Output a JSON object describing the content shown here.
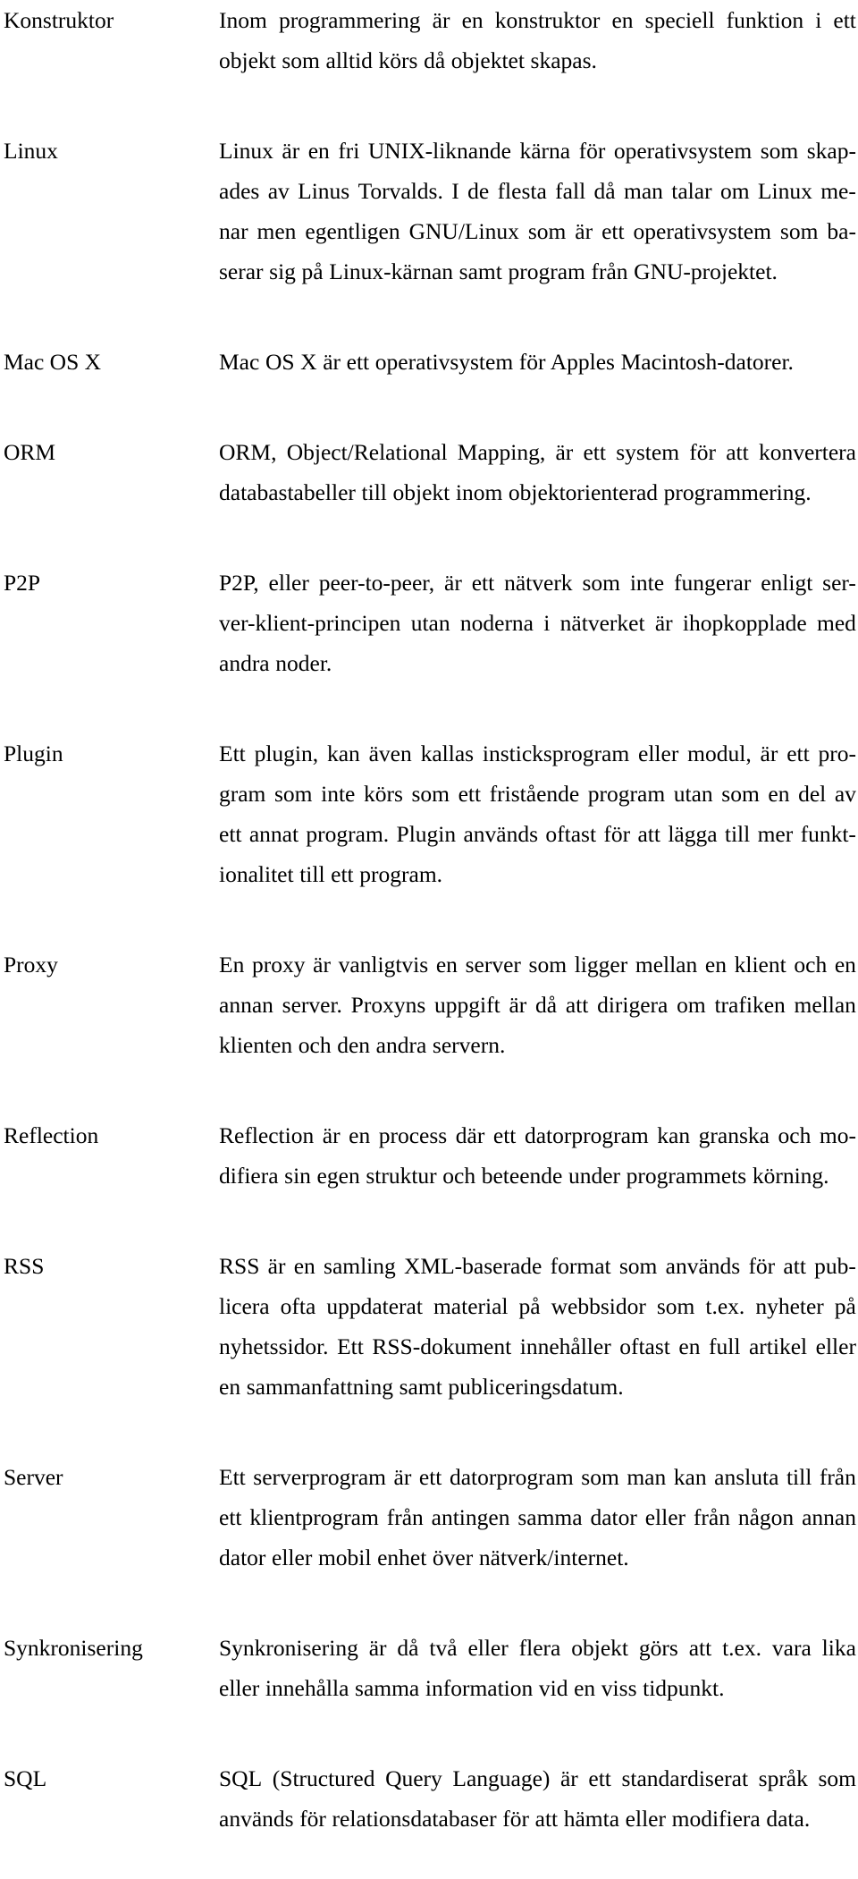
{
  "document": {
    "type": "glossary",
    "language": "sv",
    "column_headers_visible": false,
    "entries": [
      {
        "term": "Konstruktor",
        "definition": "Inom programmering är en konstruktor en speciell funktion i ett objekt som alltid körs då objektet skapas.",
        "lines": [
          {
            "words": [
              "Inom",
              "programmering",
              "är",
              "en",
              "konstruktor",
              "en",
              "speciell",
              "funktion",
              "i",
              "ett"
            ],
            "justified": true
          },
          {
            "words": [
              "objekt som alltid körs då objektet skapas."
            ],
            "justified": false
          }
        ]
      },
      {
        "term": "Linux",
        "definition": "Linux är en fri UNIX-liknande kärna för operativsystem som skapades av Linus Torvalds. I de flesta fall då man talar om Linux menar men egentligen GNU/Linux som är ett operativsystem som baserar sig på Linux-kärnan samt program från GNU-projektet.",
        "lines": [
          {
            "words": [
              "Linux",
              "är",
              "en",
              "fri",
              "UNIX-liknande",
              "kärna",
              "för",
              "operativsystem",
              "som",
              "skap-"
            ],
            "justified": true
          },
          {
            "words": [
              "ades",
              "av",
              "Linus",
              "Torvalds.",
              "I",
              "de",
              "flesta",
              "fall",
              "då",
              "man",
              "talar",
              "om",
              "Linux",
              "me-"
            ],
            "justified": true
          },
          {
            "words": [
              "nar",
              "men",
              "egentligen",
              "GNU/Linux",
              "som",
              "är",
              "ett",
              "operativsystem",
              "som",
              "ba-"
            ],
            "justified": true
          },
          {
            "words": [
              "serar sig på Linux-kärnan samt program från GNU-projektet."
            ],
            "justified": false
          }
        ]
      },
      {
        "term": "Mac OS X",
        "definition": "Mac OS X är ett operativsystem för Apples Macintosh-datorer.",
        "lines": [
          {
            "words": [
              "Mac OS X är ett operativsystem för Apples Macintosh-datorer."
            ],
            "justified": false
          }
        ]
      },
      {
        "term": "ORM",
        "definition": "ORM, Object/Relational Mapping, är ett system för att konvertera databastabeller till objekt inom objektorienterad programmering.",
        "lines": [
          {
            "words": [
              "ORM,",
              "Object/Relational",
              "Mapping,",
              "är",
              "ett",
              "system",
              "för",
              "att",
              "konvertera"
            ],
            "justified": true
          },
          {
            "words": [
              "databastabeller till objekt inom objektorienterad programmering."
            ],
            "justified": false
          }
        ]
      },
      {
        "term": "P2P",
        "definition": "P2P, eller peer-to-peer, är ett nätverk som inte fungerar enligt server-klient-principen utan noderna i nätverket är ihopkopplade med andra noder.",
        "lines": [
          {
            "words": [
              "P2P,",
              "eller",
              "peer-to-peer,",
              "är",
              "ett",
              "nätverk",
              "som",
              "inte",
              "fungerar",
              "enligt",
              "ser-"
            ],
            "justified": true
          },
          {
            "words": [
              "ver-klient-principen",
              "utan",
              "noderna",
              "i",
              "nätverket",
              "är",
              "ihopkopplade",
              "med"
            ],
            "justified": true
          },
          {
            "words": [
              "andra noder."
            ],
            "justified": false
          }
        ]
      },
      {
        "term": "Plugin",
        "definition": "Ett plugin, kan även kallas insticksprogram eller modul, är ett program som inte körs som ett fristående program utan som en del av ett annat program. Plugin används oftast för att lägga till mer funktionalitet till ett program.",
        "lines": [
          {
            "words": [
              "Ett",
              "plugin,",
              "kan",
              "även",
              "kallas",
              "insticksprogram",
              "eller",
              "modul,",
              "är",
              "ett",
              "pro-"
            ],
            "justified": true
          },
          {
            "words": [
              "gram",
              "som",
              "inte",
              "körs",
              "som",
              "ett",
              "fristående",
              "program",
              "utan",
              "som",
              "en",
              "del",
              "av"
            ],
            "justified": true
          },
          {
            "words": [
              "ett",
              "annat",
              "program.",
              "Plugin",
              "används",
              "oftast",
              "för",
              "att",
              "lägga",
              "till",
              "mer",
              "funkt-"
            ],
            "justified": true
          },
          {
            "words": [
              "ionalitet till ett program."
            ],
            "justified": false
          }
        ]
      },
      {
        "term": "Proxy",
        "definition": "En proxy är vanligtvis en server som ligger mellan en klient och en annan server. Proxyns uppgift är då att dirigera om trafiken mellan klienten och den andra servern.",
        "lines": [
          {
            "words": [
              "En",
              "proxy",
              "är",
              "vanligtvis",
              "en",
              "server",
              "som",
              "ligger",
              "mellan",
              "en",
              "klient",
              "och",
              "en"
            ],
            "justified": true
          },
          {
            "words": [
              "annan",
              "server.",
              "Proxyns",
              "uppgift",
              "är",
              "då",
              "att",
              "dirigera",
              "om",
              "trafiken",
              "mellan"
            ],
            "justified": true
          },
          {
            "words": [
              "klienten och den andra servern."
            ],
            "justified": false
          }
        ]
      },
      {
        "term": "Reflection",
        "definition": "Reflection är en process där ett datorprogram kan granska och modifiera sin egen struktur och beteende under programmets körning.",
        "lines": [
          {
            "words": [
              "Reflection",
              "är",
              "en",
              "process",
              "där",
              "ett",
              "datorprogram",
              "kan",
              "granska",
              "och",
              "mo-"
            ],
            "justified": true
          },
          {
            "words": [
              "difiera sin egen struktur och beteende under programmets körning."
            ],
            "justified": false
          }
        ]
      },
      {
        "term": "RSS",
        "definition": "RSS är en samling XML-baserade format som används för att publicera ofta uppdaterat material på webbsidor som t.ex. nyheter på nyhetssidor. Ett RSS-dokument innehåller oftast en full artikel eller en sammanfattning samt publiceringsdatum.",
        "lines": [
          {
            "words": [
              "RSS",
              "är",
              "en",
              "samling",
              "XML-baserade",
              "format",
              "som",
              "används",
              "för",
              "att",
              "pub-"
            ],
            "justified": true
          },
          {
            "words": [
              "licera",
              "ofta",
              "uppdaterat",
              "material",
              "på",
              "webbsidor",
              "som",
              "t.ex.",
              "nyheter",
              "på"
            ],
            "justified": true
          },
          {
            "words": [
              "nyhetssidor.",
              "Ett",
              "RSS-dokument",
              "innehåller",
              "oftast",
              "en",
              "full",
              "artikel",
              "eller"
            ],
            "justified": true
          },
          {
            "words": [
              "en sammanfattning samt publiceringsdatum."
            ],
            "justified": false
          }
        ]
      },
      {
        "term": "Server",
        "definition": "Ett serverprogram är ett datorprogram som man kan ansluta till från ett klientprogram från antingen samma dator eller från någon annan dator eller mobil enhet över nätverk/internet.",
        "lines": [
          {
            "words": [
              "Ett",
              "serverprogram",
              "är",
              "ett",
              "datorprogram",
              "som",
              "man",
              "kan",
              "ansluta",
              "till",
              "från"
            ],
            "justified": true
          },
          {
            "words": [
              "ett",
              "klientprogram",
              "från",
              "antingen",
              "samma",
              "dator",
              "eller",
              "från",
              "någon",
              "annan"
            ],
            "justified": true
          },
          {
            "words": [
              "dator eller mobil enhet över nätverk/internet."
            ],
            "justified": false
          }
        ]
      },
      {
        "term": "Synkronisering",
        "definition": "Synkronisering är då två eller flera objekt görs att t.ex. vara lika eller innehålla samma information vid en viss tidpunkt.",
        "lines": [
          {
            "words": [
              "Synkronisering",
              "är",
              "då",
              "två",
              "eller",
              "flera",
              "objekt",
              "görs",
              "att",
              "t.ex.",
              "vara",
              "lika"
            ],
            "justified": true
          },
          {
            "words": [
              "eller innehålla samma information vid en viss tidpunkt."
            ],
            "justified": false
          }
        ]
      },
      {
        "term": "SQL",
        "definition": "SQL (Structured Query Language) är ett standardiserat språk som används för relationsdatabaser för att hämta eller modifiera data.",
        "lines": [
          {
            "words": [
              "SQL",
              "(Structured",
              "Query",
              "Language)",
              "är",
              "ett",
              "standardiserat",
              "språk",
              "som"
            ],
            "justified": true
          },
          {
            "words": [
              "används för relationsdatabaser för att hämta eller modifiera data."
            ],
            "justified": false
          }
        ]
      }
    ]
  }
}
